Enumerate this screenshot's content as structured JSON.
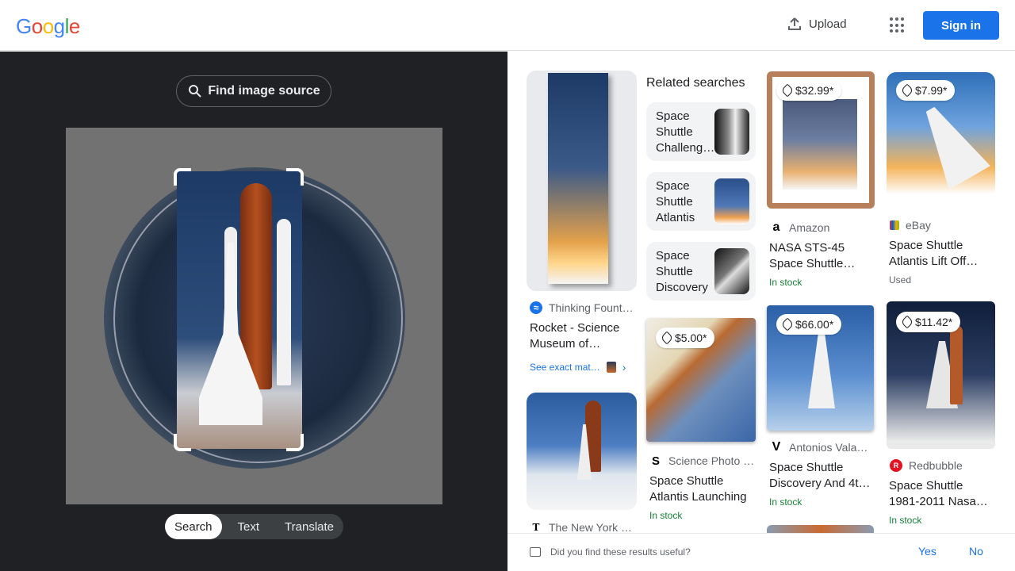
{
  "header": {
    "logo_letters": [
      {
        "char": "G",
        "color": "#4285f4"
      },
      {
        "char": "o",
        "color": "#ea4335"
      },
      {
        "char": "o",
        "color": "#fbbc05"
      },
      {
        "char": "g",
        "color": "#4285f4"
      },
      {
        "char": "l",
        "color": "#34a853"
      },
      {
        "char": "e",
        "color": "#ea4335"
      }
    ],
    "upload_label": "Upload",
    "apps_icon": "apps-grid-icon",
    "signin_label": "Sign in"
  },
  "left": {
    "find_source_label": "Find image source",
    "modes": [
      "Search",
      "Text",
      "Translate"
    ],
    "active_mode": "Search"
  },
  "related": {
    "heading": "Related searches",
    "items": [
      {
        "label": "Space Shuttle Challeng…"
      },
      {
        "label": "Space Shuttle Atlantis"
      },
      {
        "label": "Space Shuttle Discovery"
      }
    ]
  },
  "results": [
    {
      "source": "Thinking Fount…",
      "title": "Rocket - Science Museum of…",
      "exact_label": "See exact mat…"
    },
    {
      "source": "The New York …"
    },
    {
      "price": "$5.00*",
      "source": "Science Photo …",
      "title": "Space Shuttle Atlantis Launching",
      "status": "In stock"
    },
    {
      "price": "$32.99*",
      "source": "Amazon",
      "title": "NASA STS-45 Space Shuttle…",
      "status": "In stock"
    },
    {
      "price": "$66.00*",
      "source": "Antonios Vala…",
      "title": "Space Shuttle Discovery And 4t…",
      "status": "In stock"
    },
    {
      "price": "$7.99*",
      "source": "eBay",
      "title": "Space Shuttle Atlantis Lift Off…",
      "status": "Used"
    },
    {
      "price": "$11.42*",
      "source": "Redbubble",
      "title": "Space Shuttle 1981-2011 Nasa…",
      "status": "In stock"
    }
  ],
  "feedback": {
    "question": "Did you find these results useful?",
    "yes": "Yes",
    "no": "No"
  },
  "colors": {
    "accent": "#1a73e8",
    "in_stock": "#188038",
    "dark_panel": "#202124"
  }
}
